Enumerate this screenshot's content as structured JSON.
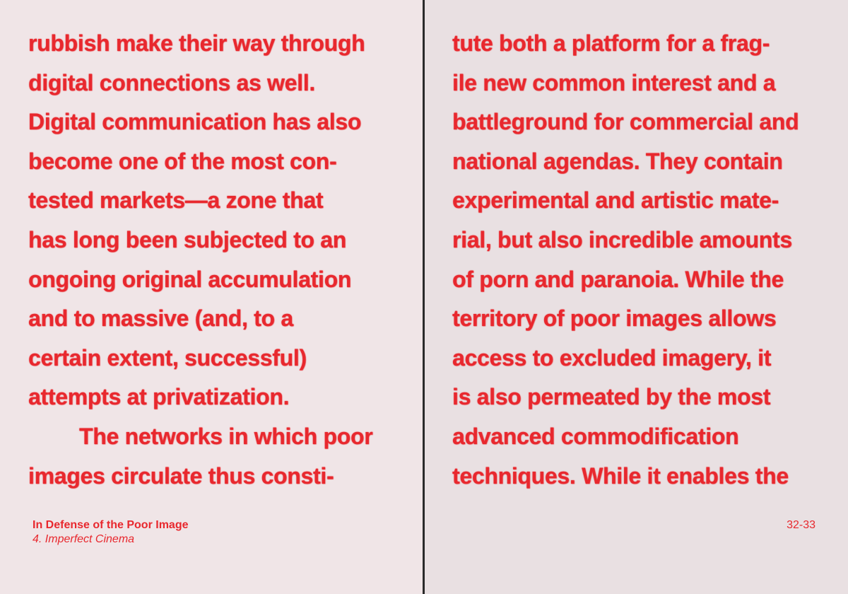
{
  "left_page": {
    "lines": [
      "rubbish make their way through",
      "digital connections as well.",
      "Digital communication has also",
      "become one of the most con-",
      "tested markets—a zone that",
      "has long been subjected to an",
      "ongoing original accumulation",
      "and to massive (and, to a",
      "certain extent, successful)",
      "attempts at privatization.",
      "The networks in which poor",
      "images circulate thus consti-"
    ]
  },
  "right_page": {
    "lines": [
      "tute both a platform for a frag-",
      "ile new common interest and a",
      "battleground for commercial and",
      "national agendas. They contain",
      "experimental and artistic mate-",
      "rial, but also incredible amounts",
      "of porn and paranoia. While the",
      "territory of poor images allows",
      "access to excluded imagery, it",
      "is also permeated by the most",
      "advanced commodification",
      "techniques. While it enables the"
    ]
  },
  "footer": {
    "book_title": "In Defense of the Poor Image",
    "chapter": "4. Imperfect Cinema",
    "page_numbers": "32-33"
  },
  "colors": {
    "text_red": "#e8282e",
    "left_page_bg": "#f0e5e7",
    "right_page_bg": "#e9e0e2",
    "spine": "#2a2a2a"
  }
}
